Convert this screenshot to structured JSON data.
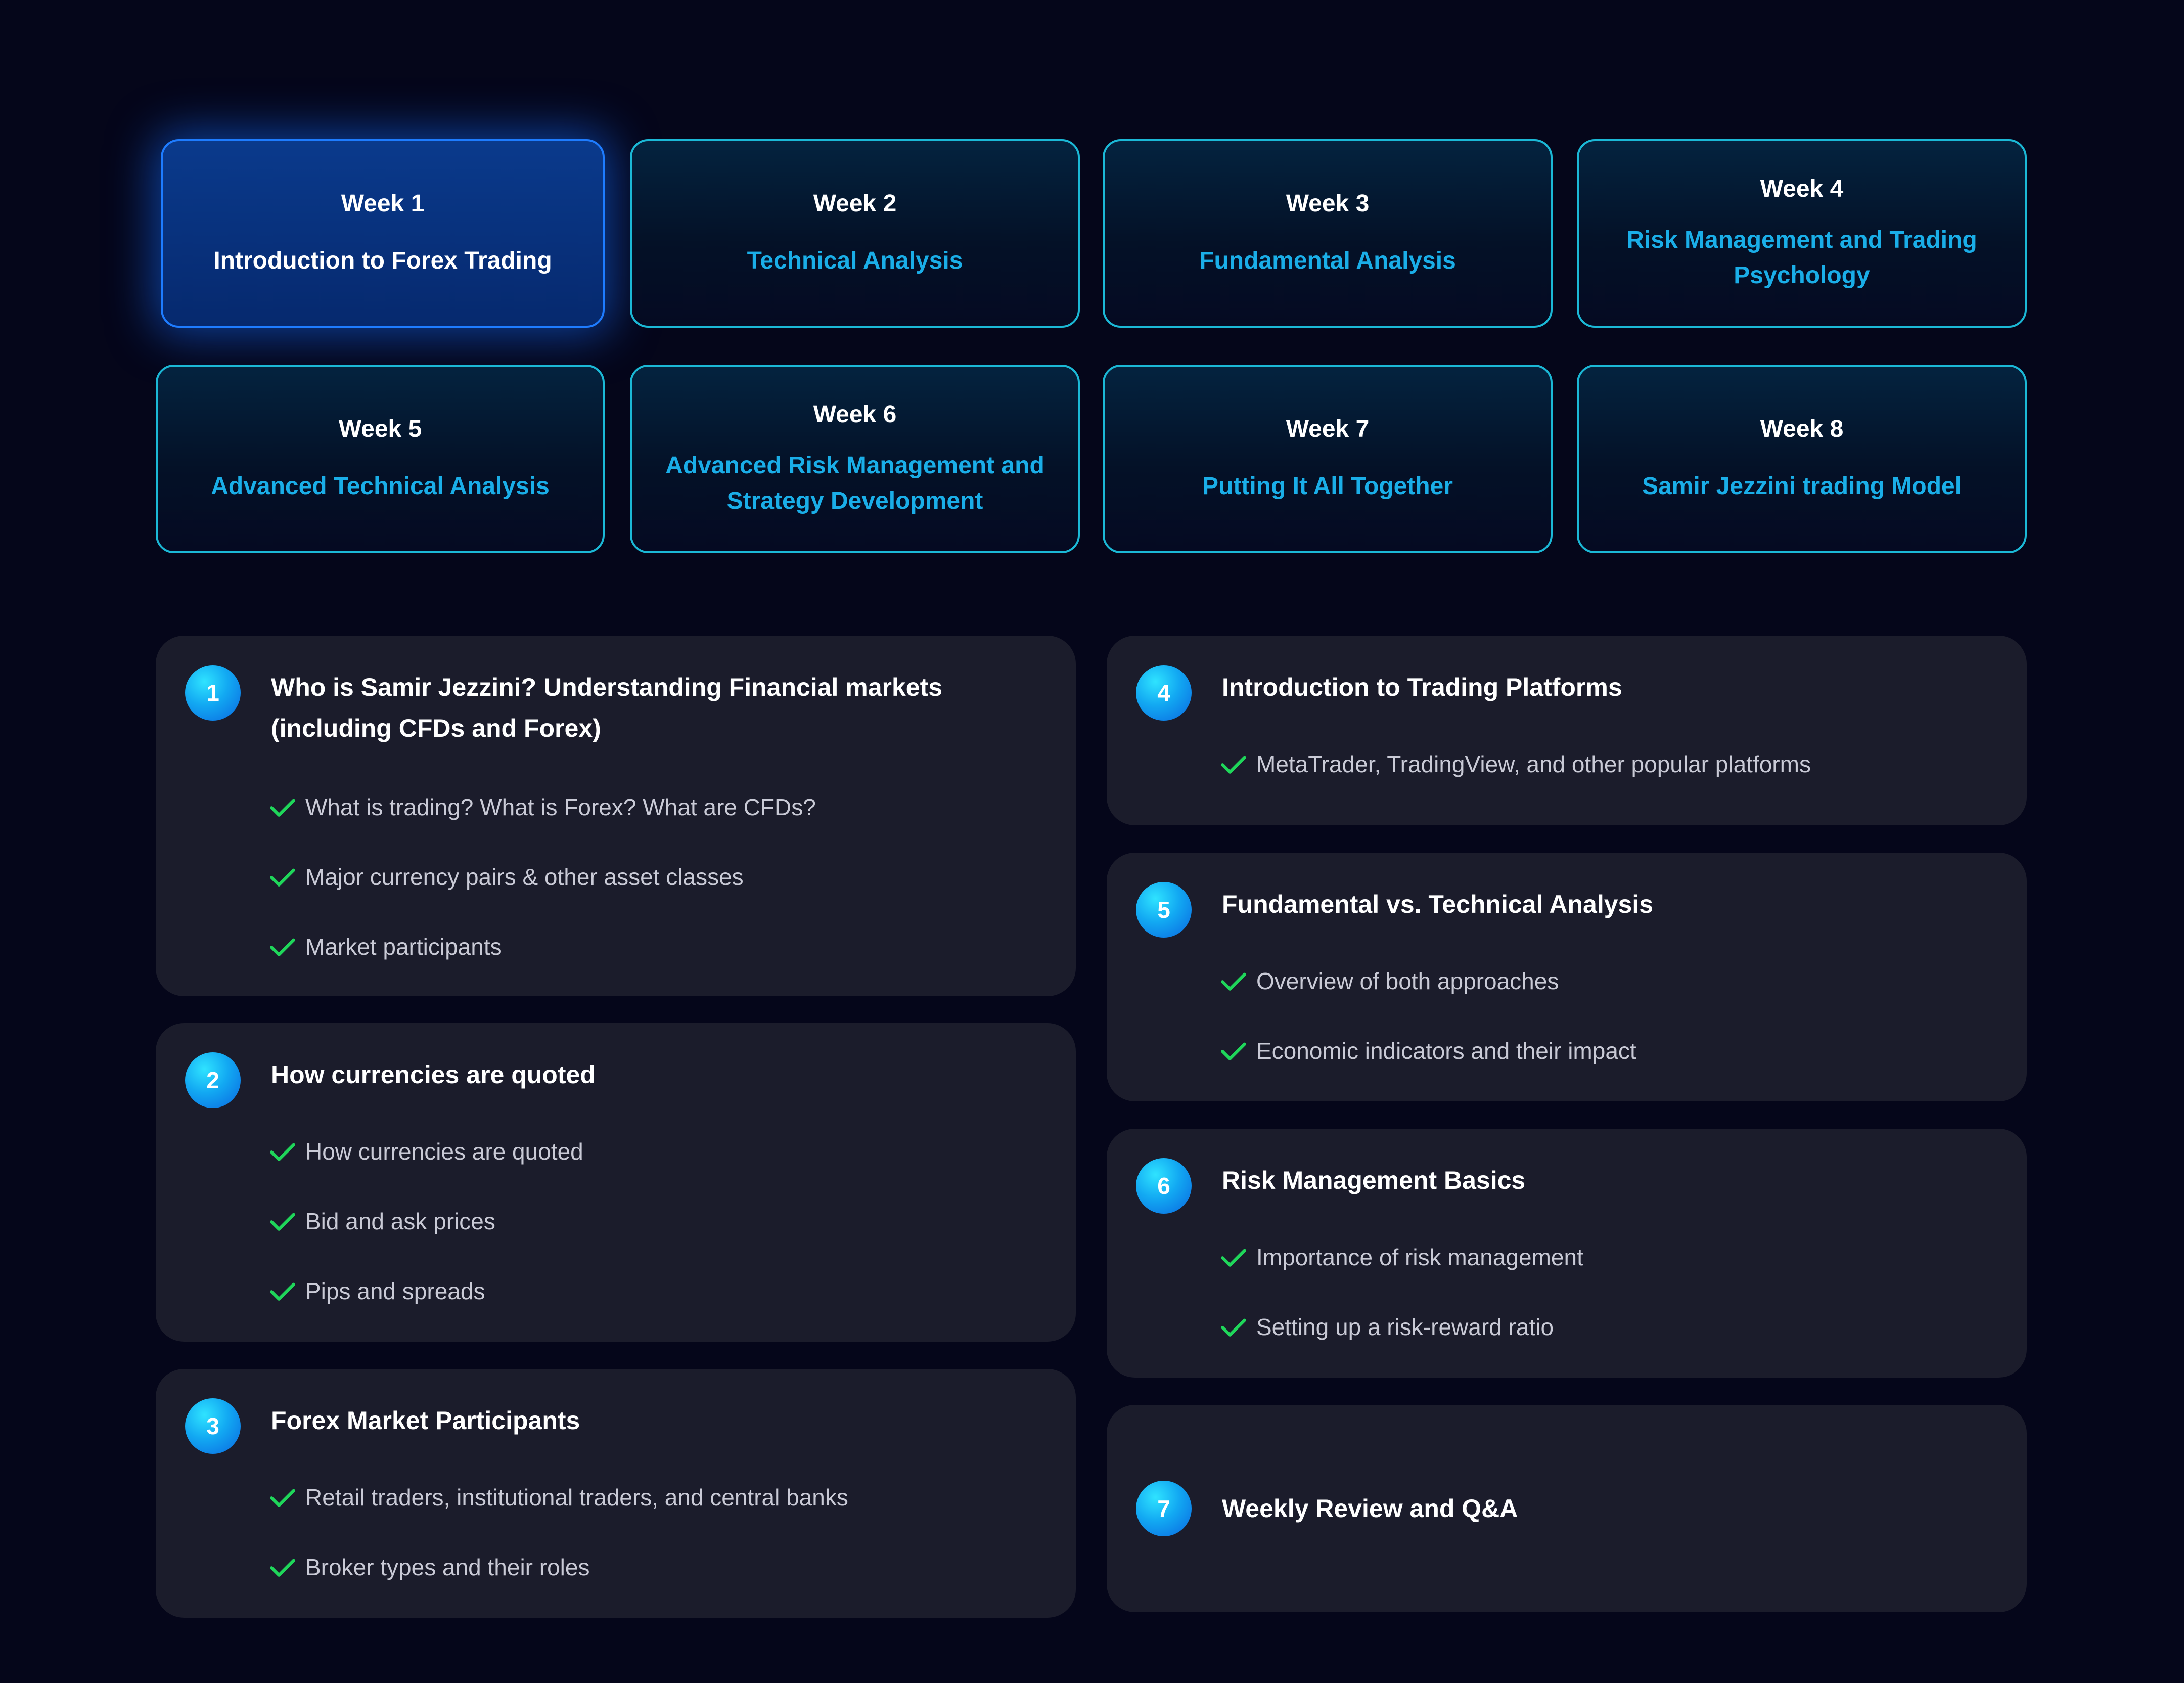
{
  "weeks": [
    {
      "label": "Week 1",
      "title": "Introduction to Forex Trading"
    },
    {
      "label": "Week 2",
      "title": "Technical Analysis"
    },
    {
      "label": "Week 3",
      "title": "Fundamental Analysis"
    },
    {
      "label": "Week 4",
      "title": "Risk Management and Trading Psychology"
    },
    {
      "label": "Week 5",
      "title": "Advanced Technical Analysis"
    },
    {
      "label": "Week 6",
      "title": "Advanced Risk Management and Strategy Development"
    },
    {
      "label": "Week 7",
      "title": "Putting It All Together"
    },
    {
      "label": "Week 8",
      "title": "Samir Jezzini trading Model"
    }
  ],
  "lessons": [
    {
      "number": "1",
      "title": "Who is Samir Jezzini? Understanding Financial markets (including CFDs and Forex)",
      "items": [
        "What is trading? What is Forex? What are CFDs?",
        "Major currency pairs & other asset classes",
        "Market participants"
      ]
    },
    {
      "number": "2",
      "title": "How currencies are quoted",
      "items": [
        "How currencies are quoted",
        "Bid and ask prices",
        "Pips and spreads"
      ]
    },
    {
      "number": "3",
      "title": "Forex Market Participants",
      "items": [
        "Retail traders, institutional traders, and central banks",
        "Broker types and their roles"
      ]
    },
    {
      "number": "4",
      "title": "Introduction to Trading Platforms",
      "items": [
        "MetaTrader, TradingView, and other popular platforms"
      ]
    },
    {
      "number": "5",
      "title": "Fundamental vs. Technical Analysis",
      "items": [
        "Overview of both approaches",
        "Economic indicators and their impact"
      ]
    },
    {
      "number": "6",
      "title": "Risk Management Basics",
      "items": [
        "Importance of risk management",
        "Setting up a risk-reward ratio"
      ]
    },
    {
      "number": "7",
      "title": "Weekly Review and Q&A",
      "items": []
    }
  ],
  "colors": {
    "background": "#05061a",
    "card": "#1b1c2b",
    "accent": "#1aaee8",
    "check": "#1fd65a",
    "active": "#0a3a8c"
  },
  "icons": {
    "check": "check-icon"
  }
}
